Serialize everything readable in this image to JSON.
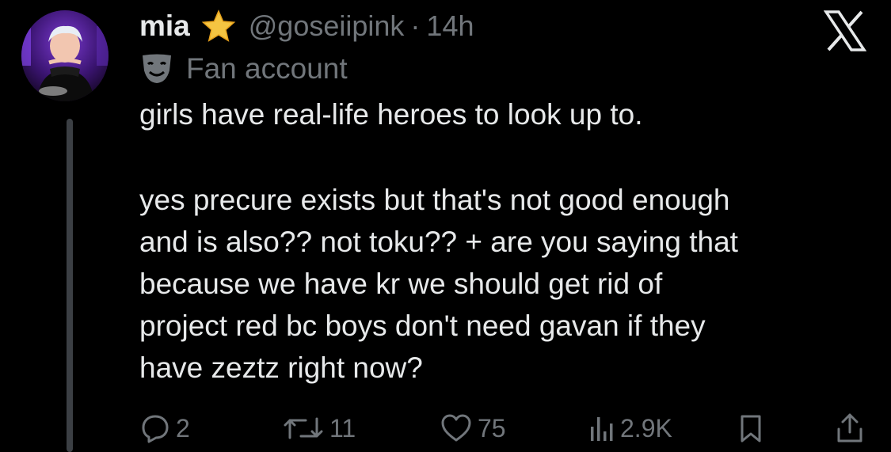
{
  "post": {
    "author_name": "mia",
    "handle": "@goseiipink",
    "separator": "·",
    "time": "14h",
    "label": "Fan account",
    "body_lines": [
      "girls have real-life heroes to look up to.",
      "yes precure exists but that's not good enough",
      "and is also?? not toku?? + are you saying that",
      "because we have kr we should get rid of",
      "project red bc boys don't need gavan if they",
      "have zeztz right now?"
    ]
  },
  "actions": {
    "replies": "2",
    "reposts": "11",
    "likes": "75",
    "views": "2.9K"
  },
  "icons": {
    "verified": "star-icon",
    "label": "theater-mask-icon",
    "platform": "x-logo-icon",
    "reply": "reply-icon",
    "repost": "repost-icon",
    "like": "heart-icon",
    "views": "views-icon",
    "bookmark": "bookmark-icon",
    "share": "share-icon"
  },
  "colors": {
    "background": "#000000",
    "text": "#e7e9ea",
    "secondary": "#71767b",
    "star": "#f5c542"
  }
}
